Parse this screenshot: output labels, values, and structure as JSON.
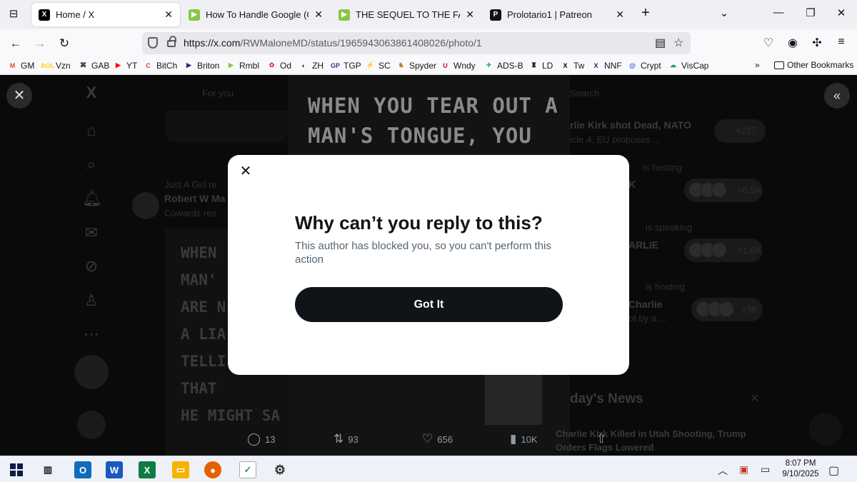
{
  "browser": {
    "tabs": [
      {
        "title": "Home / X",
        "active": true,
        "favicon": "x-logo"
      },
      {
        "title": "How To Handle Google (Gmail)",
        "active": false,
        "favicon": "rumble-icon"
      },
      {
        "title": "THE SEQUEL TO THE FALL OF TH",
        "active": false,
        "favicon": "rumble-icon"
      },
      {
        "title": "Prolotario1 | Patreon",
        "active": false,
        "favicon": "patreon-icon"
      }
    ],
    "new_tab_glyph": "+",
    "url_host": "https://x.com",
    "url_path": "/RWMaloneMD/status/1965943063861408026/photo/1",
    "bookmarks": [
      {
        "label": "GM",
        "icon": "M",
        "color": "#ea4335"
      },
      {
        "label": "Vzn",
        "icon": "AOL",
        "color": "#ffd400"
      },
      {
        "label": "GAB",
        "icon": "⌘",
        "color": "#15141a"
      },
      {
        "label": "YT",
        "icon": "▶",
        "color": "#ff0000"
      },
      {
        "label": "BitCh",
        "icon": "C",
        "color": "#e0412a"
      },
      {
        "label": "Briton",
        "icon": "▶",
        "color": "#2b2b8a"
      },
      {
        "label": "Rmbl",
        "icon": "▶",
        "color": "#85c742"
      },
      {
        "label": "Od",
        "icon": "✿",
        "color": "#e5362f"
      },
      {
        "label": "ZH",
        "icon": "◐",
        "color": "#222"
      },
      {
        "label": "TGP",
        "icon": "GP",
        "color": "#1a3f8f"
      },
      {
        "label": "SC",
        "icon": "⚡",
        "color": "#111"
      },
      {
        "label": "Spyder",
        "icon": "♞",
        "color": "#b8862b"
      },
      {
        "label": "Wndy",
        "icon": "U",
        "color": "#c8102e"
      },
      {
        "label": "ADS-B",
        "icon": "✈",
        "color": "#2e9c5a"
      },
      {
        "label": "LD",
        "icon": "♜",
        "color": "#222"
      },
      {
        "label": "Tw",
        "icon": "X",
        "color": "#000"
      },
      {
        "label": "NNF",
        "icon": "X",
        "color": "#1a2a6c"
      },
      {
        "label": "Crypt",
        "icon": "@",
        "color": "#3b5bdb"
      },
      {
        "label": "VisCap",
        "icon": "☁",
        "color": "#2e9c5a"
      }
    ],
    "other_bookmarks": "Other Bookmarks"
  },
  "background": {
    "feed_tab": "For you",
    "search_placeholder": "Search",
    "tweet_author": "Robert W Ma",
    "tweet_text": "Cowards res",
    "repost_line": "Just A Girl re",
    "photo_lines": [
      "WHEN YOU TEAR OUT A",
      "MAN'S TONGUE, YOU"
    ],
    "tweet_image_lines": [
      "WHEN",
      "MAN'",
      "ARE N",
      "A LIA",
      "TELLI",
      "THAT",
      "HE MIGHT SA"
    ],
    "actions": {
      "replies": "13",
      "reposts": "93",
      "likes": "656",
      "views": "10K"
    },
    "trends": [
      {
        "text": "rlie Kirk shot Dead, NATO",
        "sub": "icle 4, EU proposes ...",
        "count": "+217"
      },
      {
        "text": "is hosting",
        "sub": "K",
        "count": "+6.5K"
      },
      {
        "text": "is speaking",
        "sub": "ARLIE",
        "count": "+1.6K"
      },
      {
        "text": "is hosting",
        "sub": "Charlie",
        "sub2": "ot by a ...",
        "count": "+3K"
      }
    ],
    "news_heading": "day's News",
    "news_item": "Charlie Kirk Killed in Utah Shooting, Trump",
    "news_item2": "Orders Flags Lowered"
  },
  "modal": {
    "title": "Why can’t you reply to this?",
    "body": "This author has blocked you, so you can't perform this action",
    "button": "Got It"
  },
  "taskbar": {
    "time": "8:07 PM",
    "date": "9/10/2025"
  }
}
